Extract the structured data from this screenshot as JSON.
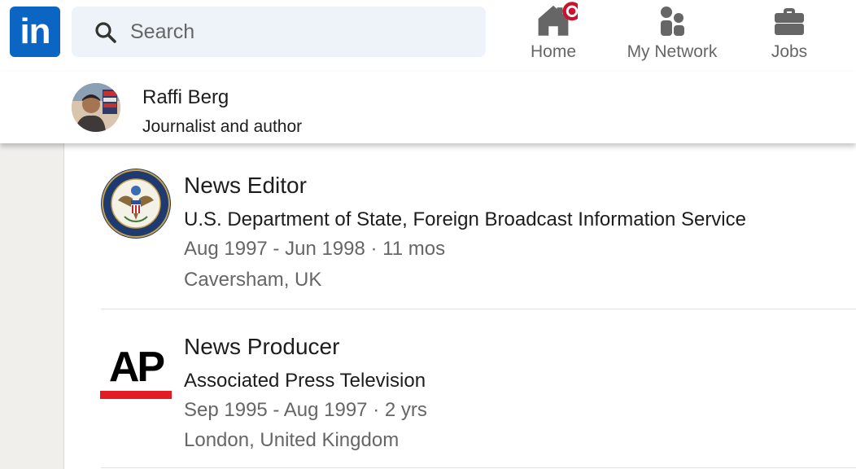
{
  "nav": {
    "logo_text": "in",
    "search_placeholder": "Search",
    "items": [
      {
        "label": "Home",
        "icon": "home-icon",
        "badge_color": "#cb112d"
      },
      {
        "label": "My Network",
        "icon": "people-icon"
      },
      {
        "label": "Jobs",
        "icon": "briefcase-icon"
      }
    ]
  },
  "profile": {
    "name": "Raffi Berg",
    "headline": "Journalist and author",
    "avatar_caption": "RED SEA SPIES"
  },
  "experience": [
    {
      "role": "News Editor",
      "company": "U.S. Department of State, Foreign Broadcast Information Service",
      "dates": "Aug 1997 - Jun 1998 · 11 mos",
      "location": "Caversham, UK",
      "logo": "department-of-state-seal"
    },
    {
      "role": "News Producer",
      "company": "Associated Press Television",
      "dates": "Sep 1995 - Aug 1997 · 2 yrs",
      "location": "London, United Kingdom",
      "logo": "ap-logo",
      "logo_text": "AP"
    }
  ],
  "colors": {
    "brand": "#0a66c2",
    "ap_red": "#e31b23",
    "notification": "#cb112d"
  }
}
